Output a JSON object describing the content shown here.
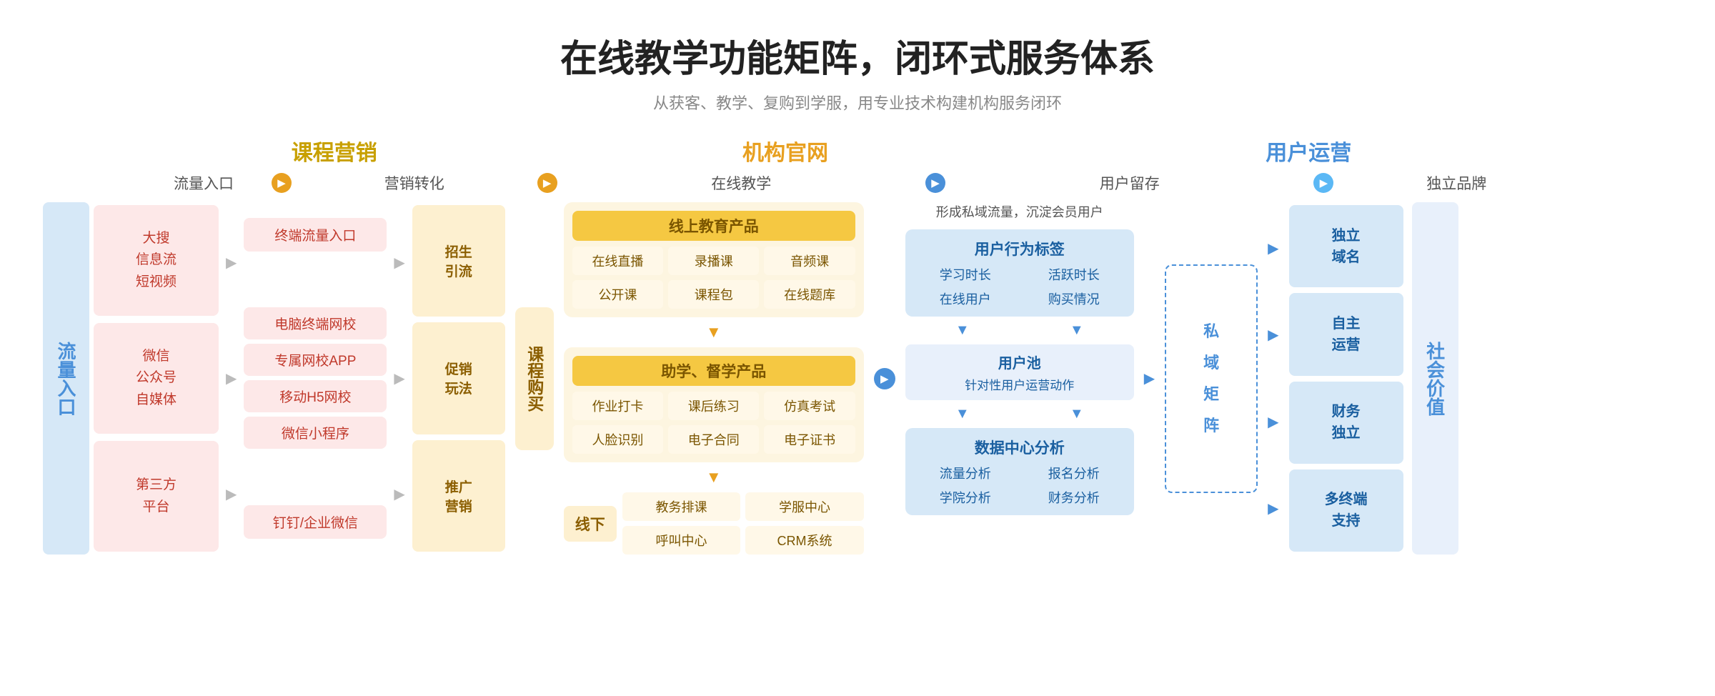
{
  "header": {
    "title": "在线教学功能矩阵，闭环式服务体系",
    "subtitle": "从获客、教学、复购到学服，用专业技术构建机构服务闭环"
  },
  "sections": {
    "marketing": "课程营销",
    "official": "机构官网",
    "user_ops": "用户运营"
  },
  "flow_steps": {
    "step1": "流量入口",
    "step2": "营销转化",
    "step3": "在线教学",
    "step4": "用户留存",
    "step5": "独立品牌"
  },
  "left_label": "流量入口",
  "right_label": "社会价值",
  "traffic_sources": [
    {
      "lines": [
        "大搜",
        "信息流",
        "短视频"
      ]
    },
    {
      "lines": [
        "微信",
        "公众号",
        "自媒体"
      ]
    },
    {
      "lines": [
        "第三方",
        "平台"
      ]
    }
  ],
  "marketing_items": [
    "终端流量入口",
    "电脑终端网校",
    "专属网校APP",
    "移动H5网校",
    "微信小程序",
    "钉钉/企业微信"
  ],
  "promo_items": [
    {
      "label": "招生引流"
    },
    {
      "label": "促销玩法"
    },
    {
      "label": "推广营销"
    }
  ],
  "online_education": {
    "title": "线上教育产品",
    "items": [
      "在线直播",
      "录播课",
      "音频课",
      "公开课",
      "课程包",
      "在线题库"
    ]
  },
  "study_products": {
    "title": "助学、督学产品",
    "items": [
      "作业打卡",
      "课后练习",
      "仿真考试",
      "人脸识别",
      "电子合同",
      "电子证书"
    ]
  },
  "offline": {
    "label": "线下",
    "items": [
      "教务排课",
      "学服中心",
      "呼叫中心",
      "CRM系统"
    ]
  },
  "course_buy_label": "课程购买",
  "user_behavior": {
    "title": "用户行为标签",
    "intro": "形成私域流量，沉淀会员用户",
    "items": [
      "学习时长",
      "活跃时长",
      "在线用户",
      "购买情况"
    ]
  },
  "user_pool": {
    "label": "用户池",
    "desc": "针对性用户运营动作"
  },
  "data_center": {
    "title": "数据中心分析",
    "items": [
      "流量分析",
      "报名分析",
      "学院分析",
      "财务分析"
    ]
  },
  "private_domain": {
    "label": "私域矩阵"
  },
  "brand_items": [
    "独立域名",
    "自主运营",
    "财务独立",
    "多终端支持"
  ]
}
